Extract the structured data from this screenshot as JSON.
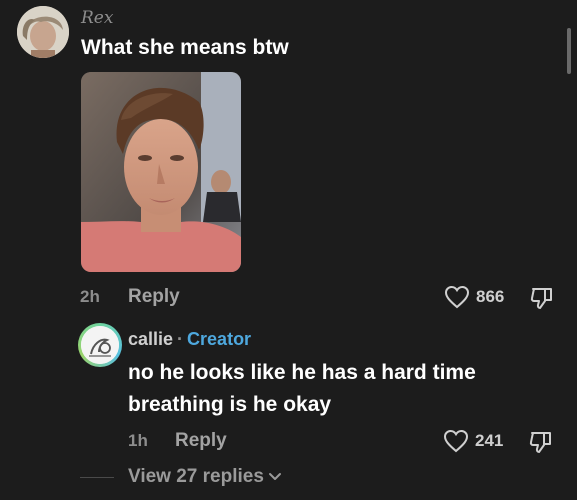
{
  "comment": {
    "username": "Rex",
    "text": "What she means btw",
    "time": "2h",
    "reply_label": "Reply",
    "likes": "866"
  },
  "reply": {
    "username": "callie",
    "separator": "·",
    "badge": "Creator",
    "text": "no he looks like he has a hard time breathing is he okay",
    "time": "1h",
    "reply_label": "Reply",
    "likes": "241"
  },
  "view_replies": {
    "label": "View 27 replies"
  },
  "icons": {
    "like": "heart-outline-icon",
    "dislike": "thumbs-down-icon",
    "expand": "chevron-down-icon"
  },
  "colors": {
    "background": "#1c1c1c",
    "creator_badge": "#4ea8de",
    "muted_text": "#8d8d8d"
  }
}
